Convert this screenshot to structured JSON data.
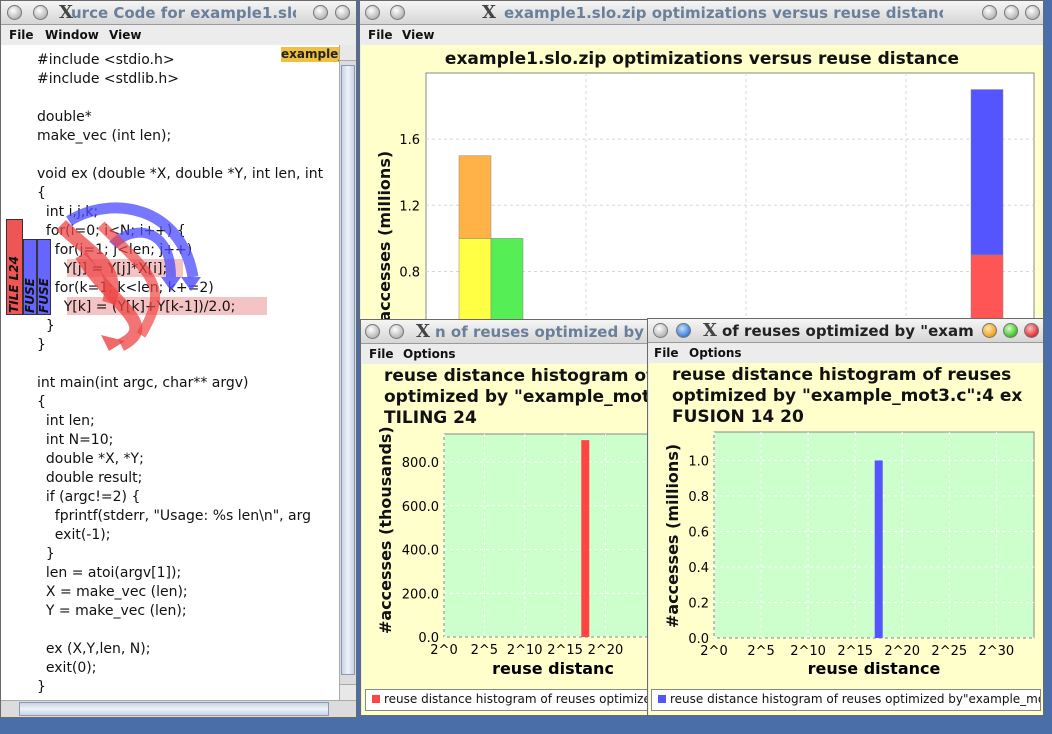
{
  "source_window": {
    "title": "urce Code for example1.slo.",
    "menu": [
      "File",
      "Window",
      "View"
    ],
    "tag": "example_",
    "side_labels": [
      "TILE L24",
      "FUSE",
      "FUSE"
    ],
    "code_lines": [
      "#include <stdio.h>",
      "#include <stdlib.h>",
      "",
      "double*",
      "make_vec (int len);",
      "",
      "void ex (double *X, double *Y, int len, int",
      "{",
      "  int i,j,k;",
      "  for(i=0; i<N; i++) {",
      "    for(j=1; j<len; j++)",
      "      Y[j] = Y[j]*X[i];",
      "    for(k=1; k<len; k+=2)",
      "      Y[k] = (Y[k]+Y[k-1])/2.0;",
      "  }",
      "}",
      "",
      "int main(int argc, char** argv)",
      "{",
      "  int len;",
      "  int N=10;",
      "  double *X, *Y;",
      "  double result;",
      "  if (argc!=2) {",
      "    fprintf(stderr, \"Usage: %s len\\n\", arg",
      "    exit(-1);",
      "  }",
      "  len = atoi(argv[1]);",
      "  X = make_vec (len);",
      "  Y = make_vec (len);",
      "",
      "  ex (X,Y,len, N);",
      "  exit(0);",
      "}"
    ]
  },
  "main_chart_window": {
    "title": "example1.slo.zip optimizations versus reuse distance",
    "menu": [
      "File",
      "View"
    ],
    "chart_data": {
      "type": "bar",
      "title": "example1.slo.zip optimizations versus reuse distance",
      "ylabel": "#accesses (millions)",
      "yticks": [
        "0.8",
        "1.2",
        "1.6"
      ],
      "ylim": [
        0.44,
        2.0
      ],
      "stacks": [
        {
          "group": 1,
          "segments": [
            {
              "value": 1.0,
              "color": "#ffff44"
            },
            {
              "value": 0.5,
              "color": "#ffb347"
            }
          ]
        },
        {
          "group": 2,
          "segments": [
            {
              "value": 1.0,
              "color": "#55ee55"
            }
          ]
        },
        {
          "group": 3,
          "segments": [
            {
              "value": 0.9,
              "color": "#ff5555"
            },
            {
              "value": 1.0,
              "color": "#5555ff"
            }
          ]
        }
      ]
    }
  },
  "tiling_window": {
    "title": "n of reuses optimized by \"ex",
    "menu": [
      "File",
      "Options"
    ],
    "chart_data": {
      "type": "bar",
      "title_lines": [
        "reuse distance histogram of",
        "optimized by \"example_mot",
        "TILING 24"
      ],
      "ylabel": "#accesses (thousands)",
      "xlabel": "reuse distanc",
      "yticks": [
        "0.0",
        "200.0",
        "400.0",
        "600.0",
        "800.0"
      ],
      "xticks": [
        "2^0",
        "2^5",
        "2^10",
        "2^15",
        "2^20"
      ],
      "bar_x": 17.5,
      "bar_value": 900,
      "bar_color": "#ff4444",
      "legend": "reuse distance histogram of reuses optimized"
    }
  },
  "fusion_window": {
    "title": "of reuses optimized by \"example_",
    "menu": [
      "File",
      "Options"
    ],
    "chart_data": {
      "type": "bar",
      "title_lines": [
        "reuse distance histogram of reuses",
        "optimized by \"example_mot3.c\":4 ex",
        "FUSION 14 20"
      ],
      "ylabel": "#accesses (millions)",
      "xlabel": "reuse distance",
      "yticks": [
        "0.0",
        "0.2",
        "0.4",
        "0.6",
        "0.8",
        "1.0"
      ],
      "xticks": [
        "2^0",
        "2^5",
        "2^10",
        "2^15",
        "2^20",
        "2^25",
        "2^30"
      ],
      "bar_x": 17.5,
      "bar_value": 1.0,
      "bar_color": "#5555ff",
      "legend": "reuse distance histogram of reuses optimized by\"example_mot"
    }
  }
}
